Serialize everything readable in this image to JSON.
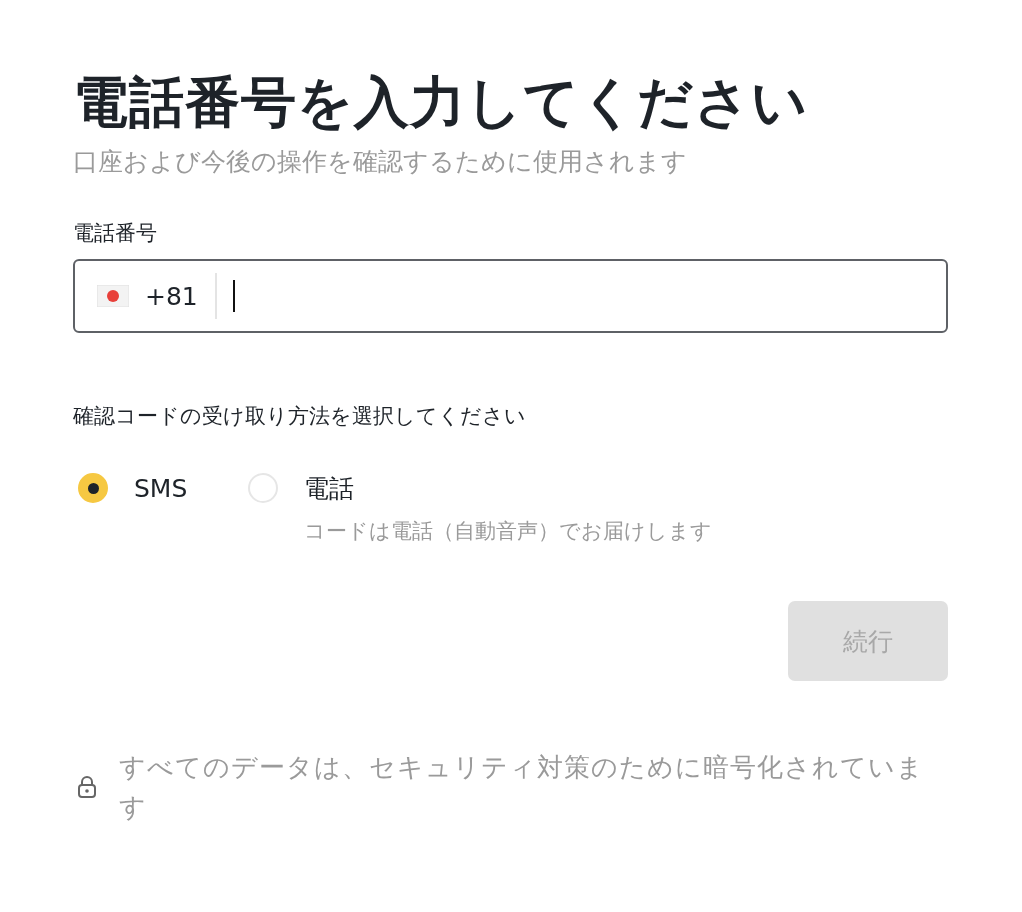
{
  "title": "電話番号を入力してください",
  "subtitle": "口座および今後の操作を確認するために使用されます",
  "phone": {
    "label": "電話番号",
    "country_code": "+81",
    "focused": true
  },
  "method": {
    "label": "確認コードの受け取り方法を選択してください",
    "options": [
      {
        "label": "SMS",
        "selected": true
      },
      {
        "label": "電話",
        "selected": false,
        "hint": "コードは電話（自動音声）でお届けします"
      }
    ]
  },
  "continue_button": {
    "label": "続行",
    "disabled": true
  },
  "security_note": "すべてのデータは、セキュリティ対策のために暗号化されています"
}
